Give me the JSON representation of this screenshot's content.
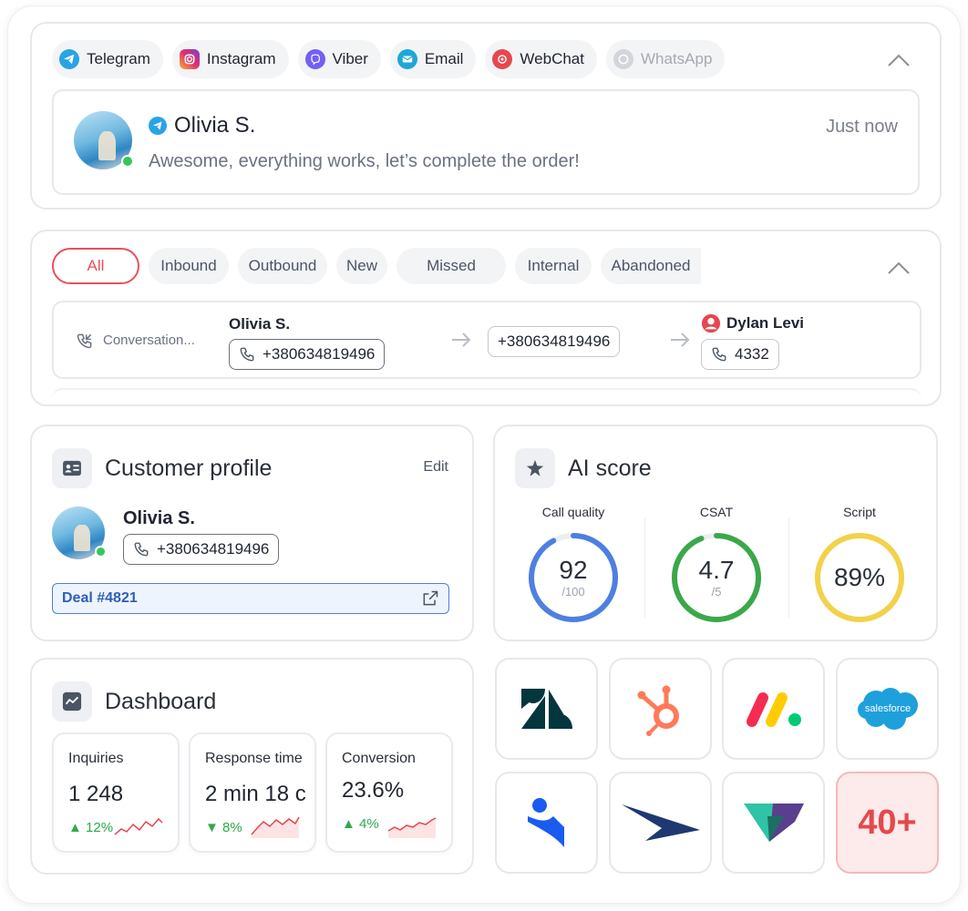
{
  "channels": {
    "items": [
      {
        "label": "Telegram",
        "icon": "telegram-icon",
        "color": "#2aa3e4"
      },
      {
        "label": "Instagram",
        "icon": "instagram-icon",
        "color": "#d6307a"
      },
      {
        "label": "Viber",
        "icon": "viber-icon",
        "color": "#7360f2"
      },
      {
        "label": "Email",
        "icon": "email-icon",
        "color": "#1fa7d8"
      },
      {
        "label": "WebChat",
        "icon": "webchat-icon",
        "color": "#e5484d"
      },
      {
        "label": "WhatsApp",
        "icon": "whatsapp-icon",
        "color": "#c4c7cc"
      }
    ],
    "message": {
      "name": "Olivia S.",
      "text": "Awesome, everything works, let’s complete the order!",
      "time": "Just now"
    }
  },
  "calls": {
    "filters": [
      "All",
      "Inbound",
      "Outbound",
      "New",
      "Missed",
      "Internal",
      "Abandoned"
    ],
    "row": {
      "type": "Conversation...",
      "caller_name": "Olivia S.",
      "caller_phone": "+380634819496",
      "line_phone": "+380634819496",
      "agent_name": "Dylan Levi",
      "agent_ext": "4332"
    }
  },
  "profile": {
    "title": "Customer profile",
    "edit": "Edit",
    "name": "Olivia S.",
    "phone": "+380634819496",
    "deal": "Deal #4821"
  },
  "ai_score": {
    "title": "AI score",
    "scores": [
      {
        "label": "Call quality",
        "value": "92",
        "sub": "/100",
        "fraction": 0.92,
        "color": "#4f7fe0"
      },
      {
        "label": "CSAT",
        "value": "4.7",
        "sub": "/5",
        "fraction": 0.94,
        "color": "#3aa84a"
      },
      {
        "label": "Script",
        "value": "89%",
        "sub": "",
        "fraction": 1.0,
        "color": "#f2d24a"
      }
    ]
  },
  "dashboard": {
    "title": "Dashboard",
    "metrics": [
      {
        "label": "Inquiries",
        "value": "1 248",
        "delta": "12%",
        "trend": "up"
      },
      {
        "label": "Response time",
        "value": "2 min 18 c",
        "delta": "8%",
        "trend": "down"
      },
      {
        "label": "Conversion",
        "value": "23.6%",
        "delta": "4%",
        "trend": "up"
      }
    ]
  },
  "integrations": {
    "tiles": [
      "zendesk-logo",
      "hubspot-logo",
      "monday-logo",
      "salesforce-logo",
      "kommo-logo",
      "dynamics-logo",
      "integration-logo",
      "more"
    ],
    "salesforce_text": "salesforce",
    "more_label": "40+"
  }
}
